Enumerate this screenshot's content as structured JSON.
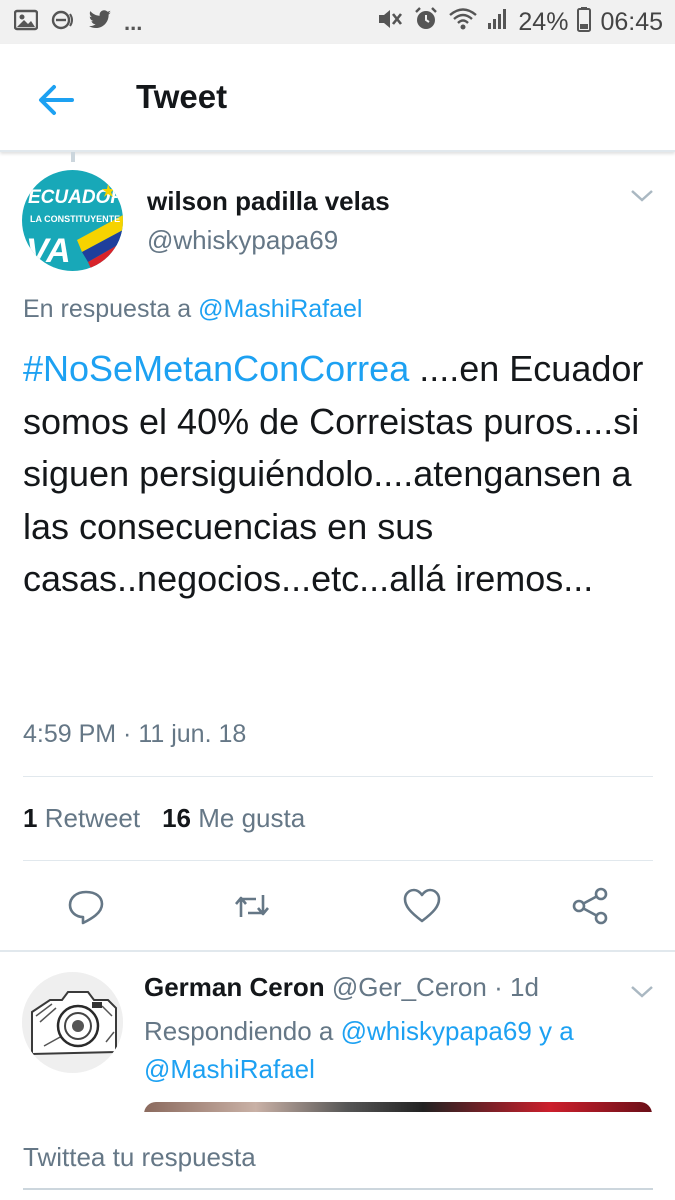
{
  "status_bar": {
    "left_icons": [
      "image-icon",
      "dnd-icon",
      "twitter-icon"
    ],
    "more": "...",
    "battery_percent": "24%",
    "time": "06:45"
  },
  "header": {
    "title": "Tweet"
  },
  "tweet": {
    "avatar": {
      "line1": "ECUADOR",
      "line2": "LA CONSTITUYENTE",
      "line3": "VA"
    },
    "author_name": "wilson padilla velas",
    "author_handle": "@whiskypapa69",
    "reply_prefix": "En respuesta a",
    "reply_to": "@MashiRafael",
    "hashtag": "#NoSeMetanConCorrea",
    "text": "....en Ecuador somos el 40% de Correistas puros....si siguen persiguiéndolo....atenganse​n a las consecuencias en sus casas..negocios...etc...allá iremos...",
    "timestamp": "4:59 PM · 11 jun. 18",
    "retweets_count": "1",
    "retweets_label": "Retweet",
    "likes_count": "16",
    "likes_label": "Me gusta"
  },
  "reply_tweet": {
    "author_name": "German Ceron",
    "author_handle": "@Ger_Ceron",
    "separator": "·",
    "age": "1d",
    "replying_prefix": "Respondiendo a",
    "replying_user1": "@whiskypapa69",
    "replying_and": "y a",
    "replying_user2": "@MashiRafael"
  },
  "composer": {
    "placeholder": "Twittea tu respuesta"
  },
  "colors": {
    "accent": "#1da1f2",
    "secondary_text": "#657786",
    "primary_text": "#14171a",
    "divider": "#e1e8ed"
  }
}
